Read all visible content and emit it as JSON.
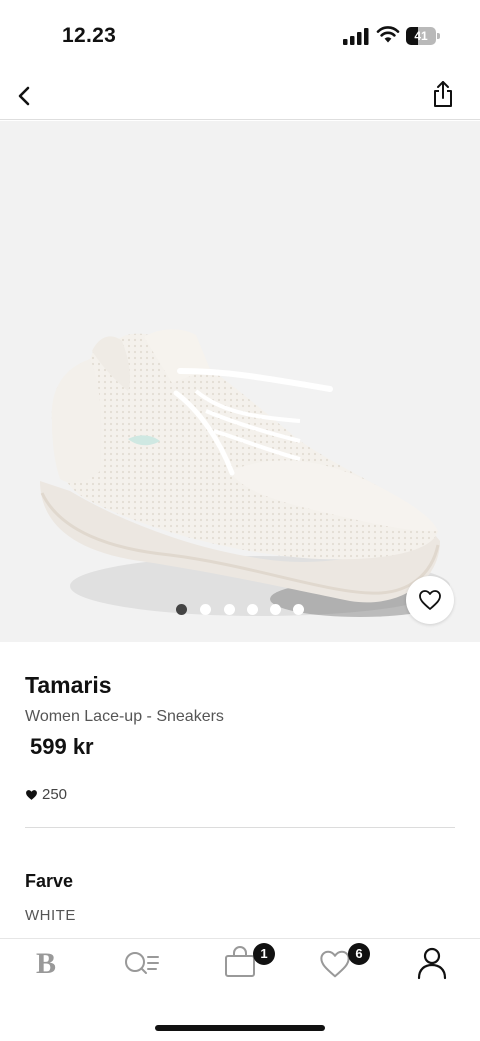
{
  "status_bar": {
    "time": "12.23",
    "battery_level": "41"
  },
  "product": {
    "brand": "Tamaris",
    "name": "Women Lace-up - Sneakers",
    "price": "599 kr",
    "likes": "250",
    "image": {
      "subject": "white-knit-lace-up-sneaker",
      "slide_count": 6,
      "active_slide": 1
    },
    "color_heading": "Farve",
    "color_value": "WHITE"
  },
  "tab_bar": {
    "home_logo": "B",
    "bag_count": "1",
    "favorites_count": "6"
  },
  "icons": {
    "back": "chevron-left-icon",
    "share": "share-icon",
    "wishlist": "heart-outline-icon",
    "search": "search-list-icon",
    "bag": "shopping-bag-icon",
    "favorites": "heart-icon",
    "profile": "user-icon"
  },
  "colors": {
    "accent": "#111111",
    "image_bg": "#f2f2f2",
    "inactive_icon": "#999999"
  }
}
